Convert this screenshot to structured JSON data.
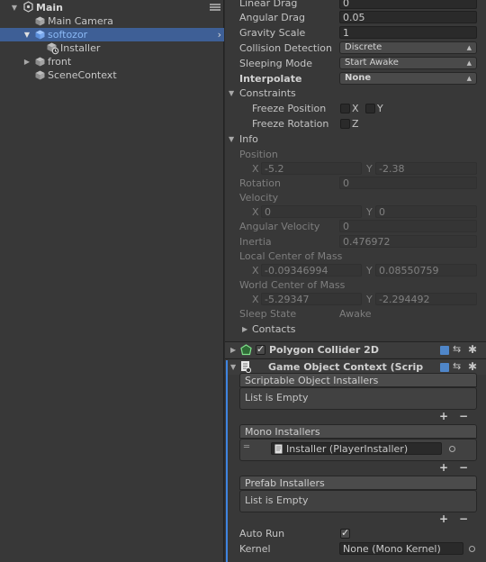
{
  "hierarchy": {
    "scene": "Main",
    "items": [
      {
        "label": "Main Camera"
      },
      {
        "label": "softozor"
      },
      {
        "label": "Installer"
      },
      {
        "label": "front"
      },
      {
        "label": "SceneContext"
      }
    ]
  },
  "rigidbody": {
    "linear_drag": {
      "label": "Linear Drag",
      "value": "0"
    },
    "angular_drag": {
      "label": "Angular Drag",
      "value": "0.05"
    },
    "gravity_scale": {
      "label": "Gravity Scale",
      "value": "1"
    },
    "collision_detection": {
      "label": "Collision Detection",
      "value": "Discrete"
    },
    "sleeping_mode": {
      "label": "Sleeping Mode",
      "value": "Start Awake"
    },
    "interpolate": {
      "label": "Interpolate",
      "value": "None"
    },
    "constraints": {
      "label": "Constraints",
      "freeze_position": {
        "label": "Freeze Position",
        "x": "X",
        "y": "Y"
      },
      "freeze_rotation": {
        "label": "Freeze Rotation",
        "z": "Z"
      }
    },
    "info": {
      "label": "Info",
      "position": {
        "label": "Position",
        "x_label": "X",
        "x": "-5.2",
        "y_label": "Y",
        "y": "-2.38"
      },
      "rotation": {
        "label": "Rotation",
        "value": "0"
      },
      "velocity": {
        "label": "Velocity",
        "x_label": "X",
        "x": "0",
        "y_label": "Y",
        "y": "0"
      },
      "angular_velocity": {
        "label": "Angular Velocity",
        "value": "0"
      },
      "inertia": {
        "label": "Inertia",
        "value": "0.476972"
      },
      "local_com": {
        "label": "Local Center of Mass",
        "x_label": "X",
        "x": "-0.09346994",
        "y_label": "Y",
        "y": "0.08550759"
      },
      "world_com": {
        "label": "World Center of Mass",
        "x_label": "X",
        "x": "-5.29347",
        "y_label": "Y",
        "y": "-2.294492"
      },
      "sleep_state": {
        "label": "Sleep State",
        "value": "Awake"
      },
      "contacts": {
        "label": "Contacts"
      }
    }
  },
  "polygon_collider": {
    "title": "Polygon Collider 2D"
  },
  "game_object_context": {
    "title": "Game Object Context (Scrip",
    "scriptable_installers": {
      "header": "Scriptable Object Installers",
      "empty": "List is Empty"
    },
    "mono_installers": {
      "header": "Mono Installers",
      "item": "Installer (PlayerInstaller)"
    },
    "prefab_installers": {
      "header": "Prefab Installers",
      "empty": "List is Empty"
    },
    "auto_run": {
      "label": "Auto Run"
    },
    "kernel": {
      "label": "Kernel",
      "value": "None (Mono Kernel)"
    },
    "plus": "+",
    "minus": "−"
  }
}
